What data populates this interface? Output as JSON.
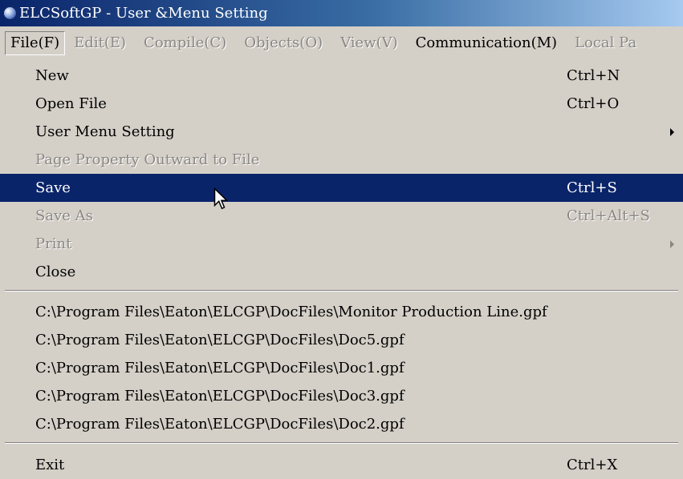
{
  "window": {
    "title": "ELCSoftGP - User &Menu Setting"
  },
  "menubar": {
    "items": [
      {
        "label": "File(F)",
        "state": "active"
      },
      {
        "label": "Edit(E)",
        "state": "disabled"
      },
      {
        "label": "Compile(C)",
        "state": "disabled"
      },
      {
        "label": "Objects(O)",
        "state": "disabled"
      },
      {
        "label": "View(V)",
        "state": "disabled"
      },
      {
        "label": "Communication(M)",
        "state": "enabled"
      },
      {
        "label": "Local Pa",
        "state": "disabled"
      }
    ]
  },
  "file_menu": {
    "items": [
      {
        "label": "New",
        "shortcut": "Ctrl+N",
        "state": "enabled"
      },
      {
        "label": "Open File",
        "shortcut": "Ctrl+O",
        "state": "enabled"
      },
      {
        "label": "User Menu Setting",
        "shortcut": "",
        "state": "enabled",
        "submenu": true
      },
      {
        "label": "Page Property Outward to File",
        "shortcut": "",
        "state": "disabled"
      },
      {
        "label": "Save",
        "shortcut": "Ctrl+S",
        "state": "highlighted"
      },
      {
        "label": "Save As",
        "shortcut": "Ctrl+Alt+S",
        "state": "disabled"
      },
      {
        "label": "Print",
        "shortcut": "",
        "state": "disabled",
        "submenu": true
      },
      {
        "label": "Close",
        "shortcut": "",
        "state": "enabled"
      }
    ],
    "recent_files": [
      "C:\\Program Files\\Eaton\\ELCGP\\DocFiles\\Monitor Production Line.gpf",
      "C:\\Program Files\\Eaton\\ELCGP\\DocFiles\\Doc5.gpf",
      "C:\\Program Files\\Eaton\\ELCGP\\DocFiles\\Doc1.gpf",
      "C:\\Program Files\\Eaton\\ELCGP\\DocFiles\\Doc3.gpf",
      "C:\\Program Files\\Eaton\\ELCGP\\DocFiles\\Doc2.gpf"
    ],
    "exit": {
      "label": "Exit",
      "shortcut": "Ctrl+X"
    }
  },
  "colors": {
    "title_gradient_start": "#0a246a",
    "title_gradient_end": "#a6caf0",
    "menu_face": "#d4d0c8",
    "highlight": "#0a246a",
    "disabled_text": "#8a8783"
  },
  "icons": {
    "app": "app-globe-icon",
    "submenu": "submenu-arrow-icon",
    "cursor": "mouse-pointer-icon"
  }
}
